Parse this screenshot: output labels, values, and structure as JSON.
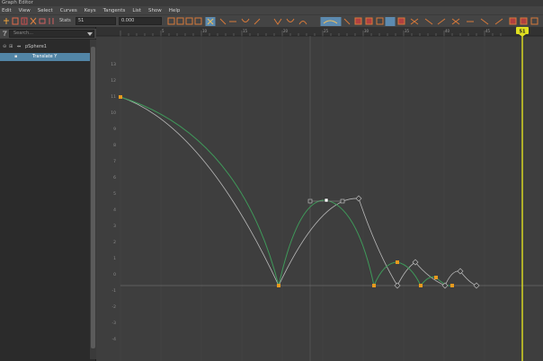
{
  "window": {
    "title": "Graph Editor"
  },
  "menu": [
    "Edit",
    "View",
    "Select",
    "Curves",
    "Keys",
    "Tangents",
    "List",
    "Show",
    "Help"
  ],
  "toolbar": {
    "stats_label": "Stats",
    "stats_value_1": "51",
    "stats_value_2": "0.000"
  },
  "outliner": {
    "search_placeholder": "Search...",
    "items": [
      {
        "label": "pSphere1",
        "selected": false
      },
      {
        "label": "Translate Y",
        "selected": true
      }
    ]
  },
  "timeline": {
    "current_frame": "51",
    "ticks": [
      "5",
      "10",
      "15",
      "20",
      "25",
      "30",
      "35",
      "40",
      "45",
      "50"
    ]
  },
  "value_ruler": [
    "13",
    "12",
    "11",
    "10",
    "9",
    "8",
    "7",
    "6",
    "5",
    "4",
    "3",
    "2",
    "1",
    "0",
    "-1",
    "-2",
    "-3",
    "-4"
  ],
  "colors": {
    "curve_active": "#3f9a5a",
    "curve_ghost": "#b9b9b9",
    "key_selected": "#e89a1e",
    "current_time": "#e0e020"
  }
}
